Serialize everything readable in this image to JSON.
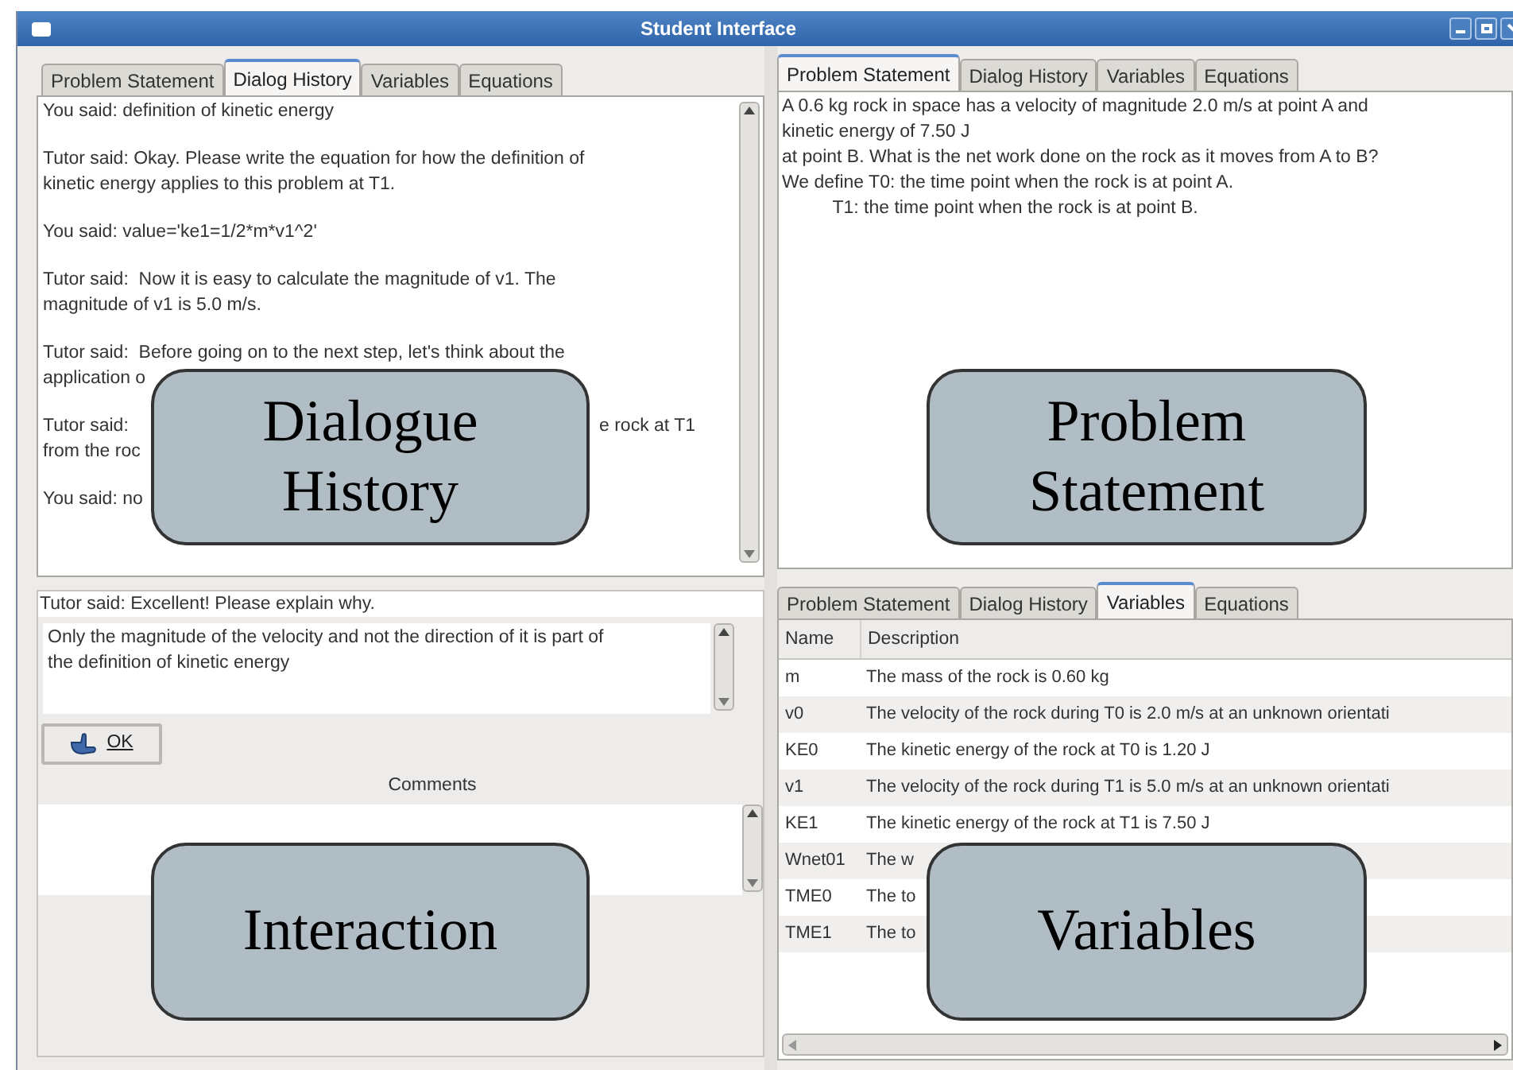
{
  "window": {
    "title": "Student Interface"
  },
  "dialog_pane": {
    "tabs": [
      {
        "label": "Problem Statement",
        "selected": false
      },
      {
        "label": "Dialog History",
        "selected": true
      },
      {
        "label": "Variables",
        "selected": false
      },
      {
        "label": "Equations",
        "selected": false
      }
    ],
    "messages": [
      {
        "text": "You said: definition of kinetic energy"
      },
      {
        "text": "Tutor said: Okay. Please write the equation for how the definition of\nkinetic energy applies to this problem at T1."
      },
      {
        "text": "You said: value='ke1=1/2*m*v1^2'"
      },
      {
        "text": "Tutor said:  Now it is easy to calculate the magnitude of v1. The\nmagnitude of v1 is 5.0 m/s."
      },
      {
        "text": "Tutor said:  Before going on to the next step, let's think about the\napplication o"
      },
      {
        "text": "Tutor said:\nfrom the roc",
        "right": "e rock at T1"
      },
      {
        "text": "You said: no"
      }
    ],
    "callout": "Dialogue History"
  },
  "interaction": {
    "prompt": "Tutor said: Excellent! Please explain why.",
    "answer": "Only the magnitude of the velocity and not the direction of it is part of\nthe definition of kinetic energy",
    "ok_button": "OK",
    "comments_label": "Comments",
    "callout": "Interaction"
  },
  "problem_pane": {
    "tabs": [
      {
        "label": "Problem Statement",
        "selected": true
      },
      {
        "label": "Dialog History",
        "selected": false
      },
      {
        "label": "Variables",
        "selected": false
      },
      {
        "label": "Equations",
        "selected": false
      }
    ],
    "text": "A 0.6 kg rock in space has a velocity of magnitude 2.0 m/s at point A and\nkinetic energy of 7.50 J\nat point B. What is the net work done on the rock as it moves from A to B?\nWe define T0: the time point when the rock is at point A.\n          T1: the time point when the rock is at point B.",
    "callout": "Problem Statement"
  },
  "variables_pane": {
    "tabs": [
      {
        "label": "Problem Statement",
        "selected": false
      },
      {
        "label": "Dialog History",
        "selected": false
      },
      {
        "label": "Variables",
        "selected": true
      },
      {
        "label": "Equations",
        "selected": false
      }
    ],
    "columns": [
      "Name",
      "Description"
    ],
    "rows": [
      {
        "name": "m",
        "description": "The mass of the rock is 0.60 kg"
      },
      {
        "name": "v0",
        "description": "The velocity of the rock during T0 is 2.0 m/s at an unknown orientati"
      },
      {
        "name": "KE0",
        "description": "The kinetic energy of the rock at T0 is 1.20 J"
      },
      {
        "name": "v1",
        "description": "The velocity of the rock during T1 is 5.0 m/s at an unknown orientati"
      },
      {
        "name": "KE1",
        "description": "The kinetic energy of the rock at T1 is 7.50 J"
      },
      {
        "name": "Wnet01",
        "description": "The w"
      },
      {
        "name": "TME0",
        "description": "The to"
      },
      {
        "name": "TME1",
        "description": "The to"
      }
    ],
    "callout": "Variables"
  }
}
